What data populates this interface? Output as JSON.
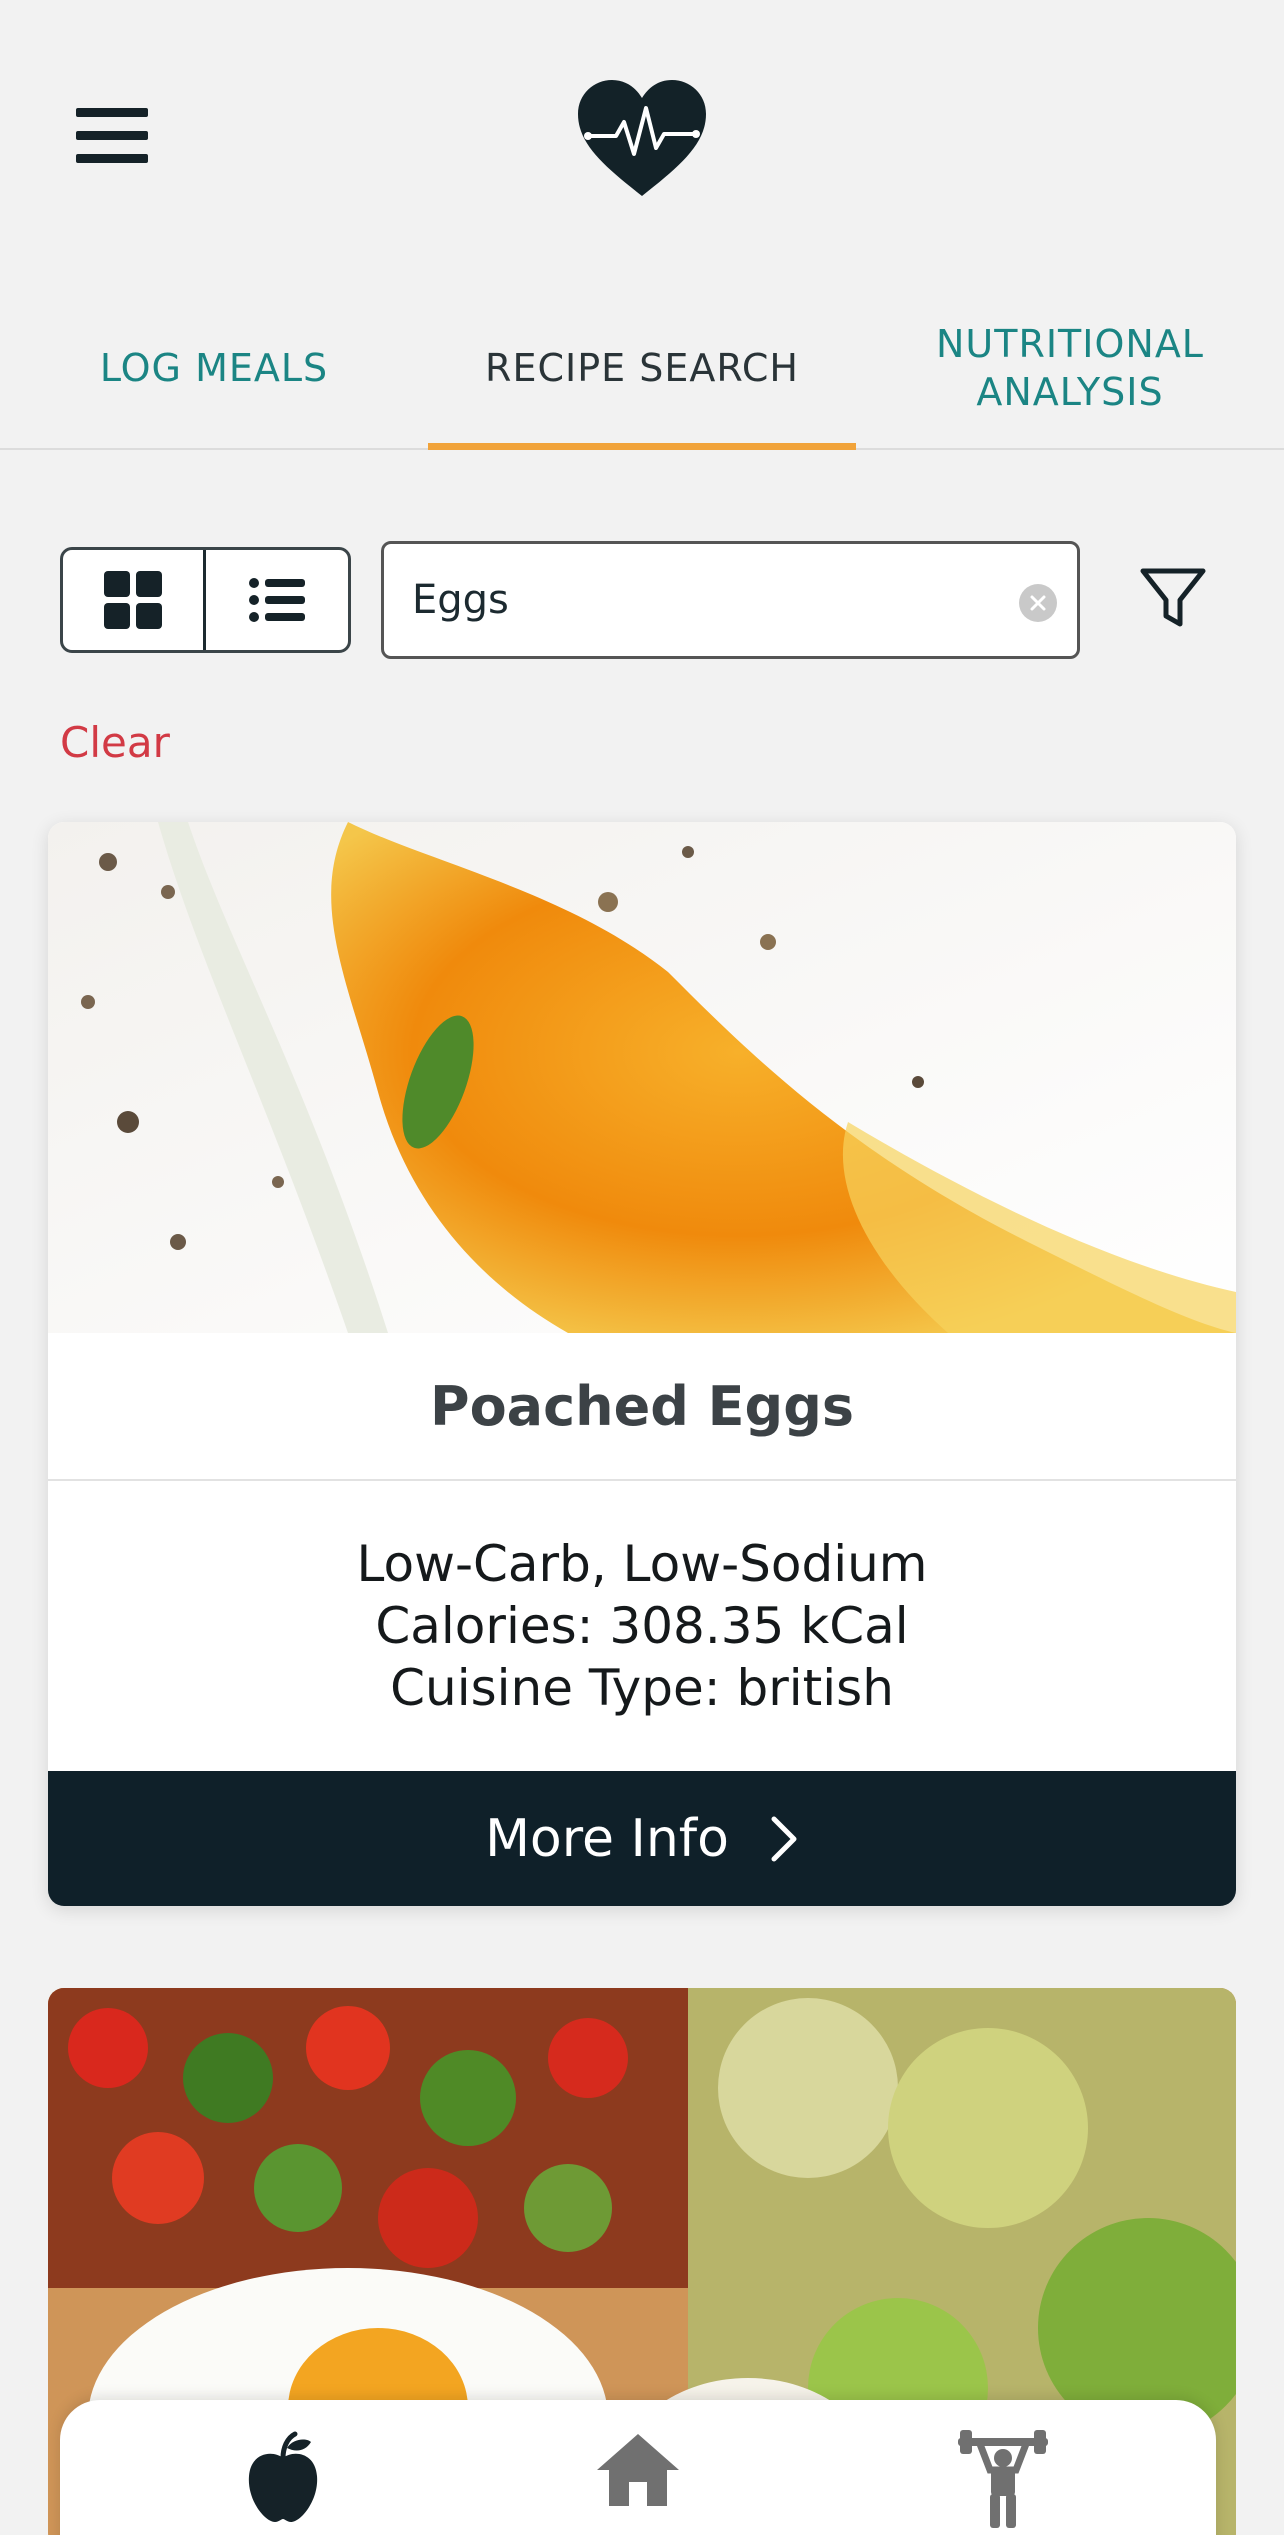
{
  "header": {
    "menu_icon": "hamburger-menu-icon",
    "logo_icon": "heart-pulse-icon",
    "brand_color": "#132228"
  },
  "tabs": [
    {
      "label": "LOG MEALS",
      "active": false
    },
    {
      "label": "RECIPE SEARCH",
      "active": true
    },
    {
      "label": "NUTRITIONAL ANALYSIS",
      "active": false
    }
  ],
  "colors": {
    "accent_teal": "#1b8584",
    "active_indicator": "#f1a33a",
    "clear_red": "#d23a45",
    "button_dark": "#0f2029"
  },
  "search": {
    "value": "Eggs",
    "clear_label": "Clear",
    "view_modes": [
      "grid",
      "list"
    ],
    "active_view": "grid"
  },
  "results": [
    {
      "title": "Poached Eggs",
      "labels": "Low-Carb, Low-Sodium",
      "calories": "Calories: 308.35 kCal",
      "cuisine": "Cuisine Type: british",
      "button_label": "More Info"
    }
  ],
  "bottom_nav": {
    "items": [
      "apple-icon",
      "home-icon",
      "weightlifter-icon"
    ],
    "active": "apple-icon"
  }
}
